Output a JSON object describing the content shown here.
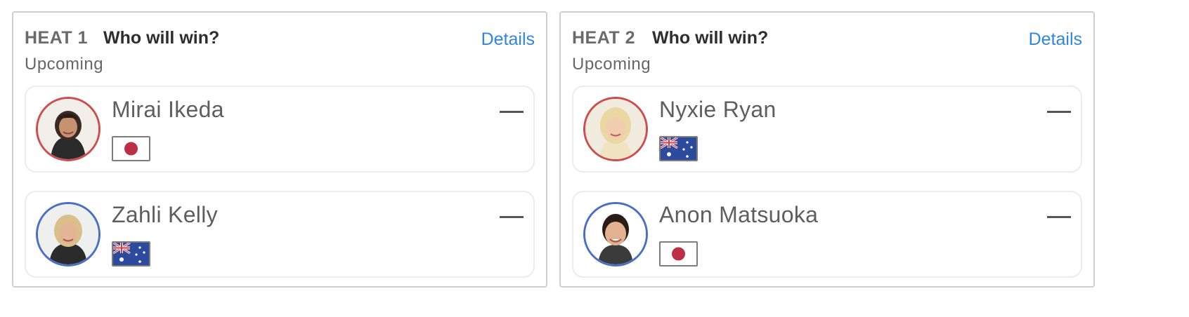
{
  "heats": [
    {
      "label": "HEAT 1",
      "question": "Who will win?",
      "details_label": "Details",
      "status": "Upcoming",
      "surfers": [
        {
          "name": "Mirai Ikeda",
          "country": "Japan",
          "flag_icon": "japan-flag-icon",
          "ring_color": "#cc4e4e",
          "score": ""
        },
        {
          "name": "Zahli Kelly",
          "country": "Australia",
          "flag_icon": "australia-flag-icon",
          "ring_color": "#4a6fc4",
          "score": ""
        }
      ]
    },
    {
      "label": "HEAT 2",
      "question": "Who will win?",
      "details_label": "Details",
      "status": "Upcoming",
      "surfers": [
        {
          "name": "Nyxie Ryan",
          "country": "Australia",
          "flag_icon": "australia-flag-icon",
          "ring_color": "#cc4e4e",
          "score": ""
        },
        {
          "name": "Anon Matsuoka",
          "country": "Japan",
          "flag_icon": "japan-flag-icon",
          "ring_color": "#4a6fc4",
          "score": ""
        }
      ]
    }
  ],
  "colors": {
    "accent_link": "#2f86e0",
    "ring_red": "#cc4e4e",
    "ring_blue": "#4a6fc4",
    "japan_red": "#bc2f44",
    "australia_blue": "#2d4b9c"
  }
}
